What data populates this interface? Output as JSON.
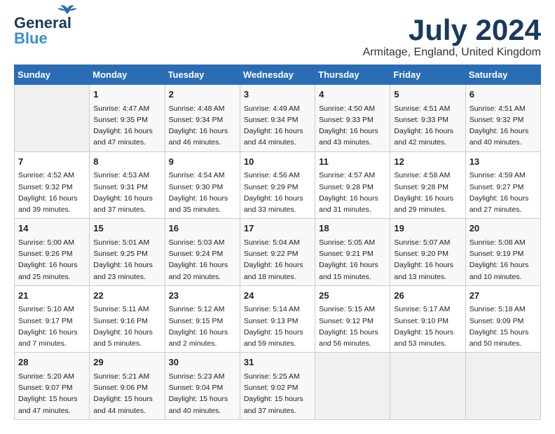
{
  "logo": {
    "line1": "General",
    "line2": "Blue"
  },
  "title": "July 2024",
  "location": "Armitage, England, United Kingdom",
  "days_header": [
    "Sunday",
    "Monday",
    "Tuesday",
    "Wednesday",
    "Thursday",
    "Friday",
    "Saturday"
  ],
  "weeks": [
    [
      {
        "day": "",
        "info": ""
      },
      {
        "day": "1",
        "info": "Sunrise: 4:47 AM\nSunset: 9:35 PM\nDaylight: 16 hours\nand 47 minutes."
      },
      {
        "day": "2",
        "info": "Sunrise: 4:48 AM\nSunset: 9:34 PM\nDaylight: 16 hours\nand 46 minutes."
      },
      {
        "day": "3",
        "info": "Sunrise: 4:49 AM\nSunset: 9:34 PM\nDaylight: 16 hours\nand 44 minutes."
      },
      {
        "day": "4",
        "info": "Sunrise: 4:50 AM\nSunset: 9:33 PM\nDaylight: 16 hours\nand 43 minutes."
      },
      {
        "day": "5",
        "info": "Sunrise: 4:51 AM\nSunset: 9:33 PM\nDaylight: 16 hours\nand 42 minutes."
      },
      {
        "day": "6",
        "info": "Sunrise: 4:51 AM\nSunset: 9:32 PM\nDaylight: 16 hours\nand 40 minutes."
      }
    ],
    [
      {
        "day": "7",
        "info": "Sunrise: 4:52 AM\nSunset: 9:32 PM\nDaylight: 16 hours\nand 39 minutes."
      },
      {
        "day": "8",
        "info": "Sunrise: 4:53 AM\nSunset: 9:31 PM\nDaylight: 16 hours\nand 37 minutes."
      },
      {
        "day": "9",
        "info": "Sunrise: 4:54 AM\nSunset: 9:30 PM\nDaylight: 16 hours\nand 35 minutes."
      },
      {
        "day": "10",
        "info": "Sunrise: 4:56 AM\nSunset: 9:29 PM\nDaylight: 16 hours\nand 33 minutes."
      },
      {
        "day": "11",
        "info": "Sunrise: 4:57 AM\nSunset: 9:28 PM\nDaylight: 16 hours\nand 31 minutes."
      },
      {
        "day": "12",
        "info": "Sunrise: 4:58 AM\nSunset: 9:28 PM\nDaylight: 16 hours\nand 29 minutes."
      },
      {
        "day": "13",
        "info": "Sunrise: 4:59 AM\nSunset: 9:27 PM\nDaylight: 16 hours\nand 27 minutes."
      }
    ],
    [
      {
        "day": "14",
        "info": "Sunrise: 5:00 AM\nSunset: 9:26 PM\nDaylight: 16 hours\nand 25 minutes."
      },
      {
        "day": "15",
        "info": "Sunrise: 5:01 AM\nSunset: 9:25 PM\nDaylight: 16 hours\nand 23 minutes."
      },
      {
        "day": "16",
        "info": "Sunrise: 5:03 AM\nSunset: 9:24 PM\nDaylight: 16 hours\nand 20 minutes."
      },
      {
        "day": "17",
        "info": "Sunrise: 5:04 AM\nSunset: 9:22 PM\nDaylight: 16 hours\nand 18 minutes."
      },
      {
        "day": "18",
        "info": "Sunrise: 5:05 AM\nSunset: 9:21 PM\nDaylight: 16 hours\nand 15 minutes."
      },
      {
        "day": "19",
        "info": "Sunrise: 5:07 AM\nSunset: 9:20 PM\nDaylight: 16 hours\nand 13 minutes."
      },
      {
        "day": "20",
        "info": "Sunrise: 5:08 AM\nSunset: 9:19 PM\nDaylight: 16 hours\nand 10 minutes."
      }
    ],
    [
      {
        "day": "21",
        "info": "Sunrise: 5:10 AM\nSunset: 9:17 PM\nDaylight: 16 hours\nand 7 minutes."
      },
      {
        "day": "22",
        "info": "Sunrise: 5:11 AM\nSunset: 9:16 PM\nDaylight: 16 hours\nand 5 minutes."
      },
      {
        "day": "23",
        "info": "Sunrise: 5:12 AM\nSunset: 9:15 PM\nDaylight: 16 hours\nand 2 minutes."
      },
      {
        "day": "24",
        "info": "Sunrise: 5:14 AM\nSunset: 9:13 PM\nDaylight: 15 hours\nand 59 minutes."
      },
      {
        "day": "25",
        "info": "Sunrise: 5:15 AM\nSunset: 9:12 PM\nDaylight: 15 hours\nand 56 minutes."
      },
      {
        "day": "26",
        "info": "Sunrise: 5:17 AM\nSunset: 9:10 PM\nDaylight: 15 hours\nand 53 minutes."
      },
      {
        "day": "27",
        "info": "Sunrise: 5:18 AM\nSunset: 9:09 PM\nDaylight: 15 hours\nand 50 minutes."
      }
    ],
    [
      {
        "day": "28",
        "info": "Sunrise: 5:20 AM\nSunset: 9:07 PM\nDaylight: 15 hours\nand 47 minutes."
      },
      {
        "day": "29",
        "info": "Sunrise: 5:21 AM\nSunset: 9:06 PM\nDaylight: 15 hours\nand 44 minutes."
      },
      {
        "day": "30",
        "info": "Sunrise: 5:23 AM\nSunset: 9:04 PM\nDaylight: 15 hours\nand 40 minutes."
      },
      {
        "day": "31",
        "info": "Sunrise: 5:25 AM\nSunset: 9:02 PM\nDaylight: 15 hours\nand 37 minutes."
      },
      {
        "day": "",
        "info": ""
      },
      {
        "day": "",
        "info": ""
      },
      {
        "day": "",
        "info": ""
      }
    ]
  ]
}
